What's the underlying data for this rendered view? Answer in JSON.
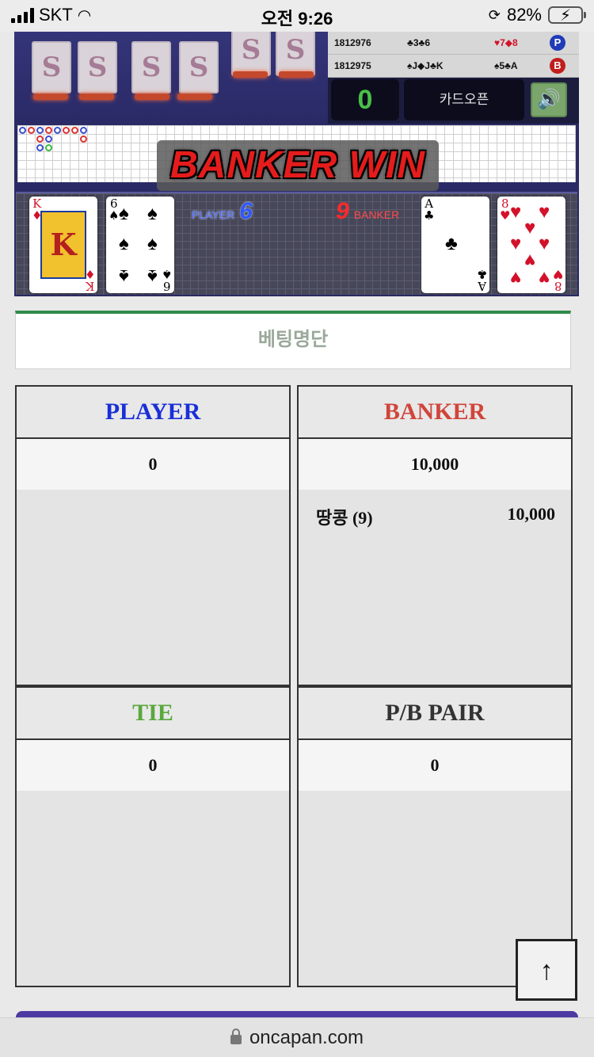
{
  "status_bar": {
    "carrier": "SKT",
    "time": "오전 9:26",
    "battery": "82%"
  },
  "game": {
    "deck_back_letter": "S",
    "history": [
      {
        "round": "1812976",
        "player_cards": "♣3♣6",
        "banker_cards": "♥7◆8",
        "badge": "P",
        "badge_color": "#1f3bb8"
      },
      {
        "round": "1812975",
        "player_cards": "♠J◆J♣K",
        "banker_cards": "♠5♣A",
        "badge": "B",
        "badge_color": "#c21d1d"
      }
    ],
    "score": "0",
    "card_open_label": "카드오픈",
    "sound_icon": "🔊",
    "result_banner": "BANKER WIN",
    "player_label": "PLAYER",
    "player_score": "6",
    "banker_label": "BANKER",
    "banker_score": "9",
    "player_cards": [
      {
        "rank": "K",
        "suit": "♦",
        "color": "red"
      },
      {
        "rank": "6",
        "suit": "♠",
        "color": "black"
      }
    ],
    "banker_cards": [
      {
        "rank": "A",
        "suit": "♣",
        "color": "black"
      },
      {
        "rank": "8",
        "suit": "♥",
        "color": "red"
      }
    ]
  },
  "betting": {
    "title": "베팅명단",
    "panels": {
      "player": {
        "label": "PLAYER",
        "color": "#1a2fd6",
        "total": "0",
        "entries": []
      },
      "banker": {
        "label": "BANKER",
        "color": "#d0453a",
        "total": "10,000",
        "entries": [
          {
            "name": "땅콩 (9)",
            "amount": "10,000"
          }
        ]
      },
      "tie": {
        "label": "TIE",
        "color": "#5aa83c",
        "total": "0",
        "entries": []
      },
      "pair": {
        "label": "P/B PAIR",
        "color": "#333333",
        "total": "0",
        "entries": []
      }
    }
  },
  "scroll_top_icon": "↑",
  "url": "oncapan.com"
}
